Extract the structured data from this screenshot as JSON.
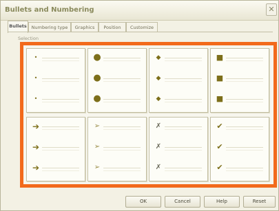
{
  "dialog": {
    "title": "Bullets and Numbering",
    "close_icon": "close-icon"
  },
  "tabs": [
    {
      "label": "Bullets",
      "active": true
    },
    {
      "label": "Numbering type",
      "active": false
    },
    {
      "label": "Graphics",
      "active": false
    },
    {
      "label": "Position",
      "active": false
    },
    {
      "label": "Customize",
      "active": false
    }
  ],
  "selection_label": "Selection",
  "bullet_styles": [
    {
      "name": "small-dot",
      "glyph": "•"
    },
    {
      "name": "large-circle",
      "glyph": "●"
    },
    {
      "name": "diamond",
      "glyph": "◆"
    },
    {
      "name": "square",
      "glyph": "■"
    },
    {
      "name": "arrow",
      "glyph": "➔"
    },
    {
      "name": "arrowhead",
      "glyph": "➢"
    },
    {
      "name": "x-mark",
      "glyph": "✗"
    },
    {
      "name": "check-mark",
      "glyph": "✔"
    }
  ],
  "buttons": {
    "ok": "OK",
    "cancel": "Cancel",
    "help": "Help",
    "reset": "Reset"
  },
  "colors": {
    "highlight_border": "#f26a1b",
    "bullet_color": "#7d6f1a"
  }
}
